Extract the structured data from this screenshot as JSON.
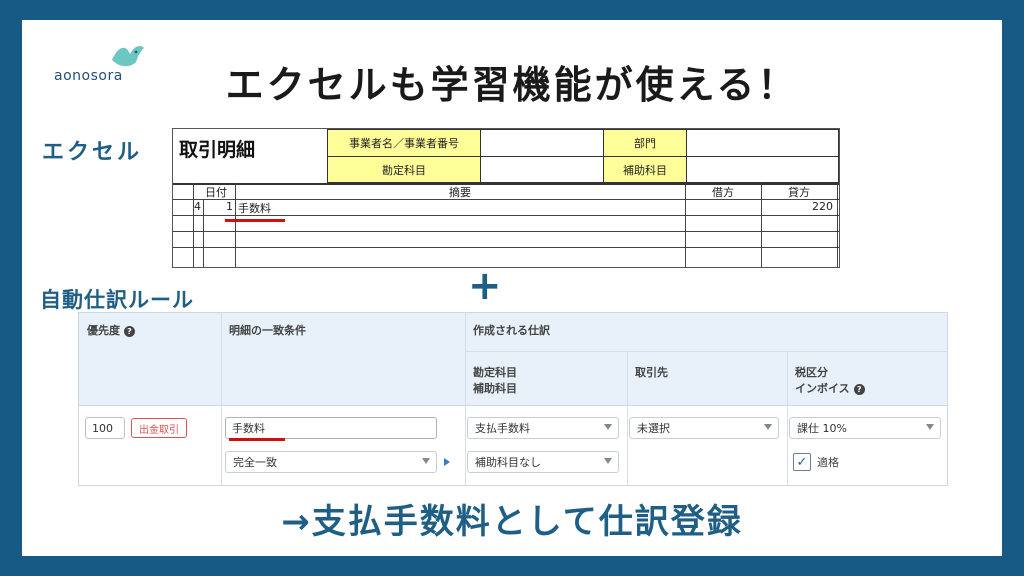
{
  "brand": {
    "logo_text": "aonosora",
    "logo_icon": "bird-icon",
    "accent": "#175a85"
  },
  "title": "エクセルも学習機能が使える！",
  "excel_label": "エクセル",
  "excel": {
    "sheet_title": "取引明細",
    "header_fields": {
      "business": "事業者名／事業者番号",
      "department": "部門",
      "account": "勘定科目",
      "sub_account": "補助科目"
    },
    "columns": {
      "date": "日付",
      "description": "摘要",
      "debit": "借方",
      "credit": "貸方"
    },
    "rows": [
      {
        "month": "4",
        "day": "1",
        "description": "手数料",
        "debit": "",
        "credit": "220"
      }
    ]
  },
  "plus": "+",
  "rule_label": "自動仕訳ルール",
  "rule": {
    "headers": {
      "priority": "優先度",
      "condition": "明細の一致条件",
      "created": "作成される仕訳",
      "account_line1": "勘定科目",
      "account_line2": "補助科目",
      "partner": "取引先",
      "tax_line1": "税区分",
      "tax_line2": "インボイス"
    },
    "priority_value": "100",
    "type_badge": "出金取引",
    "match_text": "手数料",
    "match_mode": "完全一致",
    "account": "支払手数料",
    "sub_account": "補助科目なし",
    "partner": "未選択",
    "tax": "課仕 10%",
    "invoice_checked": true,
    "invoice_label": "適格"
  },
  "result": "→支払手数料として仕訳登録"
}
